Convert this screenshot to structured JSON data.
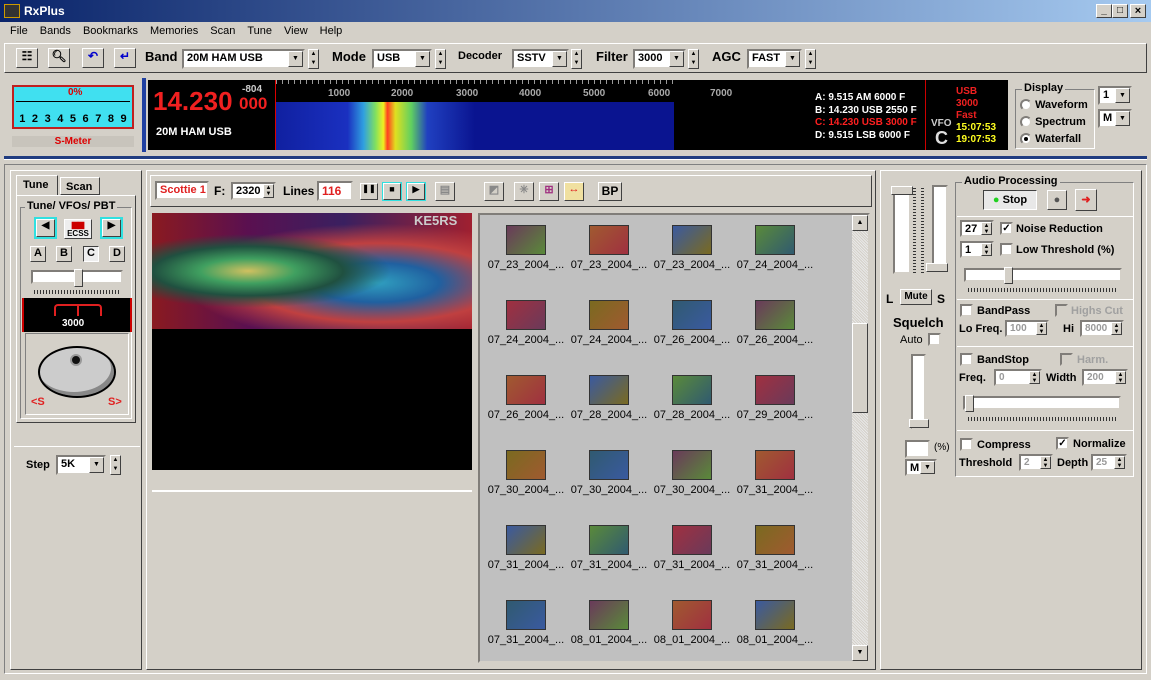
{
  "title": "RxPlus",
  "window_controls": [
    "_",
    "□",
    "×"
  ],
  "menu": [
    "File",
    "Bands",
    "Bookmarks",
    "Memories",
    "Scan",
    "Tune",
    "View",
    "Help"
  ],
  "toolbar": {
    "band_label": "Band",
    "band_value": "20M HAM USB",
    "mode_label": "Mode",
    "mode_value": "USB",
    "decoder_label": "Decoder",
    "decoder_value": "SSTV",
    "filter_label": "Filter",
    "filter_value": "3000",
    "agc_label": "AGC",
    "agc_value": "FAST"
  },
  "smeter": {
    "percent": "0%",
    "scale": [
      "1",
      "2",
      "3",
      "4",
      "5",
      "6",
      "7",
      "8",
      "9"
    ],
    "label": "S-Meter",
    "level": 0
  },
  "freq": {
    "main": "14.230",
    "offset": "-804",
    "sub": "000",
    "band": "20M HAM USB"
  },
  "waterfall": {
    "ticks": [
      "1000",
      "2000",
      "3000",
      "4000",
      "5000",
      "6000",
      "7000"
    ]
  },
  "vfos": [
    {
      "text": "A: 9.515 AM  6000 F",
      "color": "#ffffff"
    },
    {
      "text": "B: 14.230 USB 2550 F",
      "color": "#ffffff"
    },
    {
      "text": "C: 14.230 USB 3000 F",
      "color": "#ff2020"
    },
    {
      "text": "D: 9.515 LSB 6000 F",
      "color": "#ffffff"
    }
  ],
  "vfo_label": "VFO",
  "vfo_active": "C",
  "status": {
    "mode": "USB",
    "filter": "3000",
    "agc": "Fast",
    "time1": "15:07:53",
    "time2": "19:07:53"
  },
  "display": {
    "title": "Display",
    "options": [
      "Waveform",
      "Spectrum",
      "Waterfall"
    ],
    "selected": "Waterfall",
    "sel1": "1",
    "sel2": "M"
  },
  "left": {
    "tabs": [
      "Tune",
      "Scan"
    ],
    "group": "Tune/ VFOs/ PBT",
    "ecss": "ECSS",
    "vfo_buttons": [
      "A",
      "B",
      "C",
      "D"
    ],
    "pbt_value": "3000",
    "knob_left": "<S",
    "knob_right": "S>",
    "step_label": "Step",
    "step_value": "5K"
  },
  "sstv": {
    "mode": "Scottie 1",
    "f_label": "F:",
    "f_value": "2320",
    "lines_label": "Lines",
    "lines_value": "116",
    "bp": "BP",
    "callsign": "KE5RS"
  },
  "gallery": [
    [
      "07_23_2004_...",
      "07_23_2004_...",
      "07_23_2004_...",
      "07_24_2004_..."
    ],
    [
      "07_24_2004_...",
      "07_24_2004_...",
      "07_26_2004_...",
      "07_26_2004_..."
    ],
    [
      "07_26_2004_...",
      "07_28_2004_...",
      "07_28_2004_...",
      "07_29_2004_..."
    ],
    [
      "07_30_2004_...",
      "07_30_2004_...",
      "07_30_2004_...",
      "07_31_2004_..."
    ],
    [
      "07_31_2004_...",
      "07_31_2004_...",
      "07_31_2004_...",
      "07_31_2004_..."
    ],
    [
      "07_31_2004_...",
      "08_01_2004_...",
      "08_01_2004_...",
      "08_01_2004_..."
    ]
  ],
  "volume": {
    "l": "L",
    "mute": "Mute",
    "s": "S",
    "squelch": "Squelch",
    "auto": "Auto",
    "pct": "(%)",
    "sel": "M"
  },
  "audio": {
    "title": "Audio Processing",
    "stop": "Stop",
    "nr_value": "27",
    "nr_label": "Noise Reduction",
    "lt_value": "1",
    "lt_label": "Low Threshold (%)",
    "bandpass": "BandPass",
    "highs_cut": "Highs Cut",
    "lo_label": "Lo Freq.",
    "lo_value": "100",
    "hi_label": "Hi",
    "hi_value": "8000",
    "bandstop": "BandStop",
    "harm": "Harm.",
    "freq_label": "Freq.",
    "freq_value": "0",
    "width_label": "Width",
    "width_value": "200",
    "compress": "Compress",
    "normalize": "Normalize",
    "threshold_label": "Threshold",
    "threshold_value": "2",
    "depth_label": "Depth",
    "depth_value": "25"
  }
}
